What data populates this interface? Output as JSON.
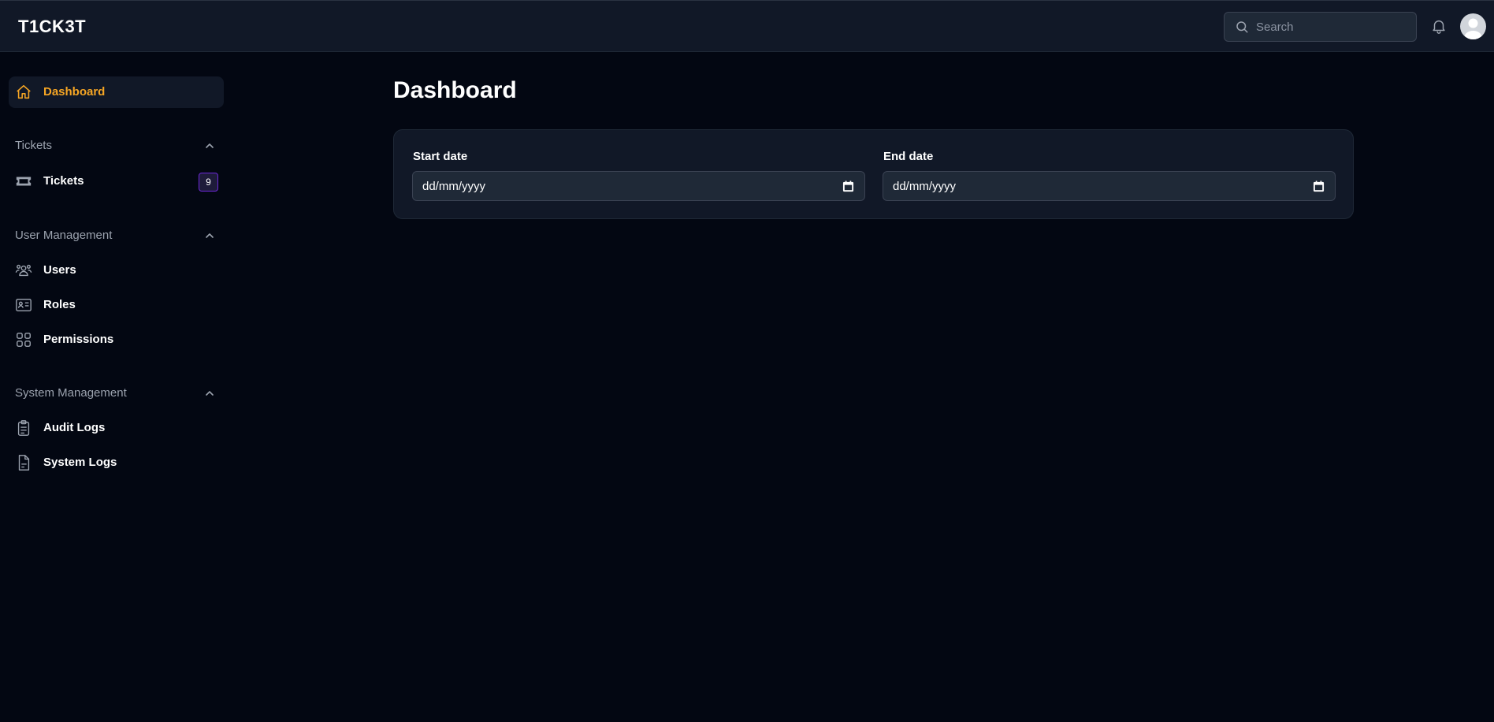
{
  "app": {
    "brand": "T1CK3T"
  },
  "header": {
    "search_placeholder": "Search",
    "icons": {
      "search": "search-icon",
      "notifications": "bell-icon",
      "avatar": "user-avatar"
    }
  },
  "sidebar": {
    "dashboard": {
      "label": "Dashboard",
      "icon": "home-icon",
      "active": true
    },
    "sections": [
      {
        "title": "Tickets",
        "items": [
          {
            "label": "Tickets",
            "icon": "ticket-icon",
            "badge": "9"
          }
        ]
      },
      {
        "title": "User Management",
        "items": [
          {
            "label": "Users",
            "icon": "users-icon"
          },
          {
            "label": "Roles",
            "icon": "id-card-icon"
          },
          {
            "label": "Permissions",
            "icon": "grid-icon"
          }
        ]
      },
      {
        "title": "System Management",
        "items": [
          {
            "label": "Audit Logs",
            "icon": "clipboard-icon"
          },
          {
            "label": "System Logs",
            "icon": "document-icon"
          }
        ]
      }
    ]
  },
  "main": {
    "title": "Dashboard",
    "filters": {
      "start": {
        "label": "Start date",
        "value": "dd/mm/yyyy"
      },
      "end": {
        "label": "End date",
        "value": "dd/mm/yyyy"
      }
    }
  },
  "colors": {
    "accent": "#f5a524",
    "background": "#030712",
    "panel": "#111827",
    "badge_border": "#6d28d9"
  }
}
